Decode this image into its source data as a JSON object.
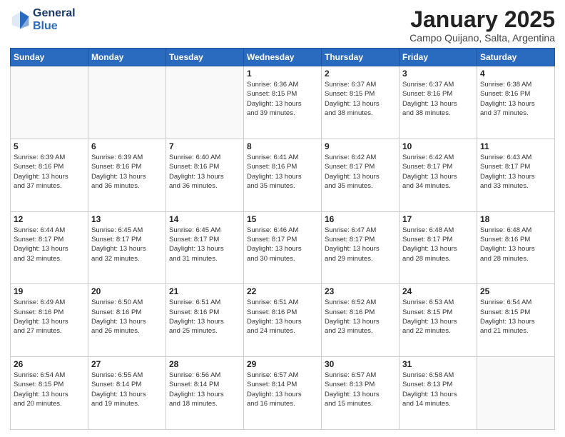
{
  "logo": {
    "line1": "General",
    "line2": "Blue"
  },
  "title": "January 2025",
  "subtitle": "Campo Quijano, Salta, Argentina",
  "weekdays": [
    "Sunday",
    "Monday",
    "Tuesday",
    "Wednesday",
    "Thursday",
    "Friday",
    "Saturday"
  ],
  "weeks": [
    [
      {
        "day": "",
        "info": ""
      },
      {
        "day": "",
        "info": ""
      },
      {
        "day": "",
        "info": ""
      },
      {
        "day": "1",
        "info": "Sunrise: 6:36 AM\nSunset: 8:15 PM\nDaylight: 13 hours\nand 39 minutes."
      },
      {
        "day": "2",
        "info": "Sunrise: 6:37 AM\nSunset: 8:15 PM\nDaylight: 13 hours\nand 38 minutes."
      },
      {
        "day": "3",
        "info": "Sunrise: 6:37 AM\nSunset: 8:16 PM\nDaylight: 13 hours\nand 38 minutes."
      },
      {
        "day": "4",
        "info": "Sunrise: 6:38 AM\nSunset: 8:16 PM\nDaylight: 13 hours\nand 37 minutes."
      }
    ],
    [
      {
        "day": "5",
        "info": "Sunrise: 6:39 AM\nSunset: 8:16 PM\nDaylight: 13 hours\nand 37 minutes."
      },
      {
        "day": "6",
        "info": "Sunrise: 6:39 AM\nSunset: 8:16 PM\nDaylight: 13 hours\nand 36 minutes."
      },
      {
        "day": "7",
        "info": "Sunrise: 6:40 AM\nSunset: 8:16 PM\nDaylight: 13 hours\nand 36 minutes."
      },
      {
        "day": "8",
        "info": "Sunrise: 6:41 AM\nSunset: 8:16 PM\nDaylight: 13 hours\nand 35 minutes."
      },
      {
        "day": "9",
        "info": "Sunrise: 6:42 AM\nSunset: 8:17 PM\nDaylight: 13 hours\nand 35 minutes."
      },
      {
        "day": "10",
        "info": "Sunrise: 6:42 AM\nSunset: 8:17 PM\nDaylight: 13 hours\nand 34 minutes."
      },
      {
        "day": "11",
        "info": "Sunrise: 6:43 AM\nSunset: 8:17 PM\nDaylight: 13 hours\nand 33 minutes."
      }
    ],
    [
      {
        "day": "12",
        "info": "Sunrise: 6:44 AM\nSunset: 8:17 PM\nDaylight: 13 hours\nand 32 minutes."
      },
      {
        "day": "13",
        "info": "Sunrise: 6:45 AM\nSunset: 8:17 PM\nDaylight: 13 hours\nand 32 minutes."
      },
      {
        "day": "14",
        "info": "Sunrise: 6:45 AM\nSunset: 8:17 PM\nDaylight: 13 hours\nand 31 minutes."
      },
      {
        "day": "15",
        "info": "Sunrise: 6:46 AM\nSunset: 8:17 PM\nDaylight: 13 hours\nand 30 minutes."
      },
      {
        "day": "16",
        "info": "Sunrise: 6:47 AM\nSunset: 8:17 PM\nDaylight: 13 hours\nand 29 minutes."
      },
      {
        "day": "17",
        "info": "Sunrise: 6:48 AM\nSunset: 8:17 PM\nDaylight: 13 hours\nand 28 minutes."
      },
      {
        "day": "18",
        "info": "Sunrise: 6:48 AM\nSunset: 8:16 PM\nDaylight: 13 hours\nand 28 minutes."
      }
    ],
    [
      {
        "day": "19",
        "info": "Sunrise: 6:49 AM\nSunset: 8:16 PM\nDaylight: 13 hours\nand 27 minutes."
      },
      {
        "day": "20",
        "info": "Sunrise: 6:50 AM\nSunset: 8:16 PM\nDaylight: 13 hours\nand 26 minutes."
      },
      {
        "day": "21",
        "info": "Sunrise: 6:51 AM\nSunset: 8:16 PM\nDaylight: 13 hours\nand 25 minutes."
      },
      {
        "day": "22",
        "info": "Sunrise: 6:51 AM\nSunset: 8:16 PM\nDaylight: 13 hours\nand 24 minutes."
      },
      {
        "day": "23",
        "info": "Sunrise: 6:52 AM\nSunset: 8:16 PM\nDaylight: 13 hours\nand 23 minutes."
      },
      {
        "day": "24",
        "info": "Sunrise: 6:53 AM\nSunset: 8:15 PM\nDaylight: 13 hours\nand 22 minutes."
      },
      {
        "day": "25",
        "info": "Sunrise: 6:54 AM\nSunset: 8:15 PM\nDaylight: 13 hours\nand 21 minutes."
      }
    ],
    [
      {
        "day": "26",
        "info": "Sunrise: 6:54 AM\nSunset: 8:15 PM\nDaylight: 13 hours\nand 20 minutes."
      },
      {
        "day": "27",
        "info": "Sunrise: 6:55 AM\nSunset: 8:14 PM\nDaylight: 13 hours\nand 19 minutes."
      },
      {
        "day": "28",
        "info": "Sunrise: 6:56 AM\nSunset: 8:14 PM\nDaylight: 13 hours\nand 18 minutes."
      },
      {
        "day": "29",
        "info": "Sunrise: 6:57 AM\nSunset: 8:14 PM\nDaylight: 13 hours\nand 16 minutes."
      },
      {
        "day": "30",
        "info": "Sunrise: 6:57 AM\nSunset: 8:13 PM\nDaylight: 13 hours\nand 15 minutes."
      },
      {
        "day": "31",
        "info": "Sunrise: 6:58 AM\nSunset: 8:13 PM\nDaylight: 13 hours\nand 14 minutes."
      },
      {
        "day": "",
        "info": ""
      }
    ]
  ]
}
